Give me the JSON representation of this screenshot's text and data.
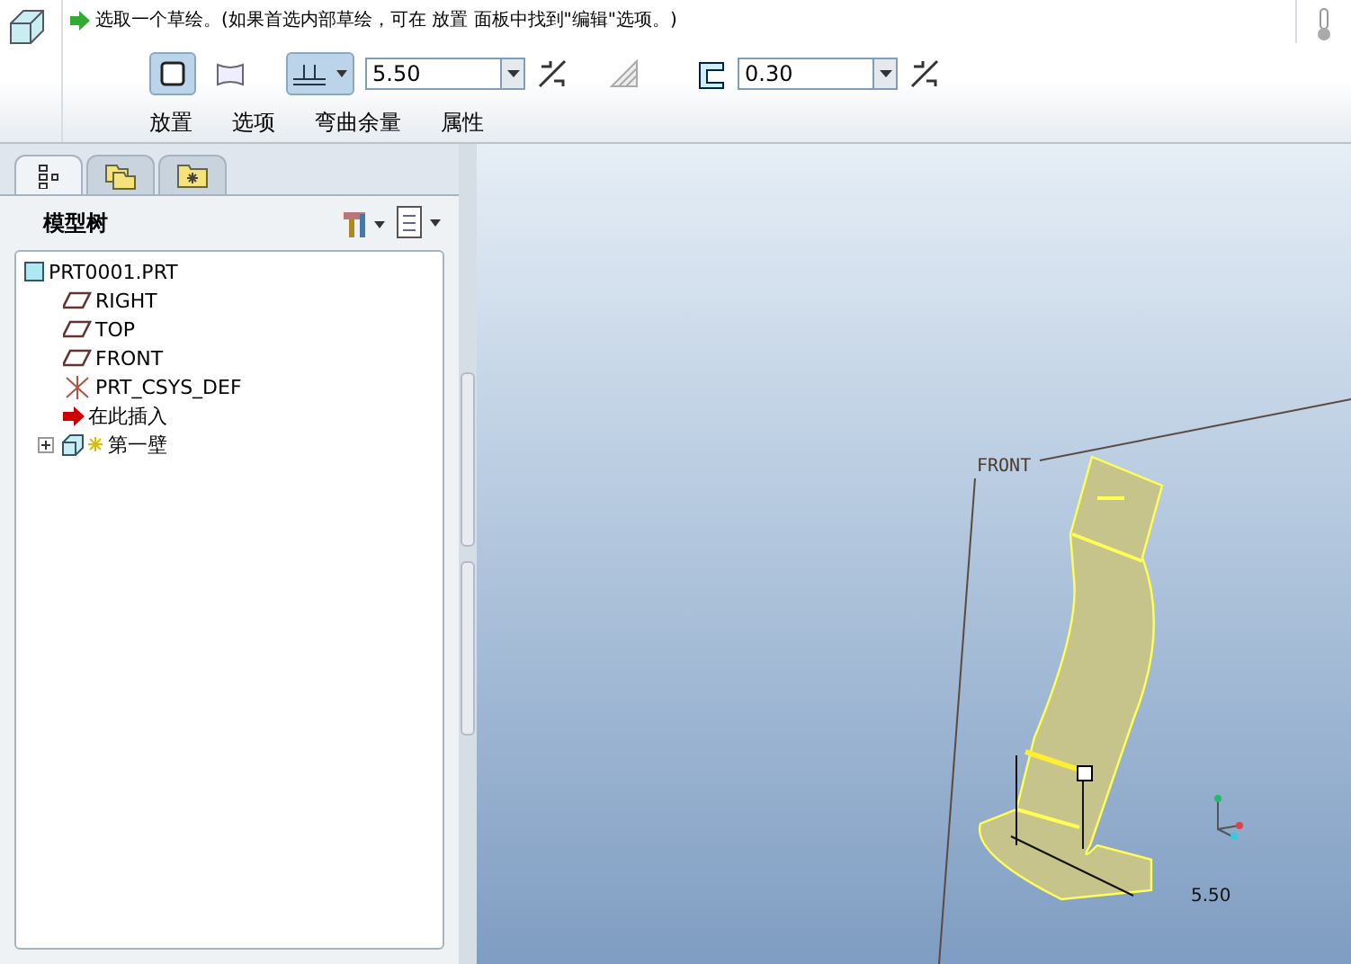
{
  "dashboard": {
    "prompt": "选取一个草绘。(如果首选内部草绘，可在 放置 面板中找到\"编辑\"选项。)",
    "wall_types": [
      {
        "kind": "flat",
        "selected": true
      },
      {
        "kind": "curved",
        "selected": false
      }
    ],
    "side_button": {
      "selected": true
    },
    "length_field": {
      "value": "5.50"
    },
    "thickness_field": {
      "value": "0.30"
    },
    "panels": [
      {
        "label": "放置"
      },
      {
        "label": "选项"
      },
      {
        "label": "弯曲余量"
      },
      {
        "label": "属性"
      }
    ]
  },
  "navigator": {
    "tabs": [
      {
        "kind": "tree",
        "selected": true
      },
      {
        "kind": "folders",
        "selected": false
      },
      {
        "kind": "favorites",
        "selected": false
      }
    ],
    "title": "模型树",
    "tree": [
      {
        "label": "PRT0001.PRT",
        "kind": "part",
        "children": [
          {
            "label": "RIGHT",
            "kind": "plane"
          },
          {
            "label": "TOP",
            "kind": "plane"
          },
          {
            "label": "FRONT",
            "kind": "plane"
          },
          {
            "label": "PRT_CSYS_DEF",
            "kind": "csys"
          },
          {
            "label": "在此插入",
            "kind": "insert"
          },
          {
            "label": "第一壁",
            "kind": "wall",
            "expanded": false
          }
        ]
      }
    ]
  },
  "graphics": {
    "plane_label": "FRONT",
    "dimension": "5.50"
  }
}
